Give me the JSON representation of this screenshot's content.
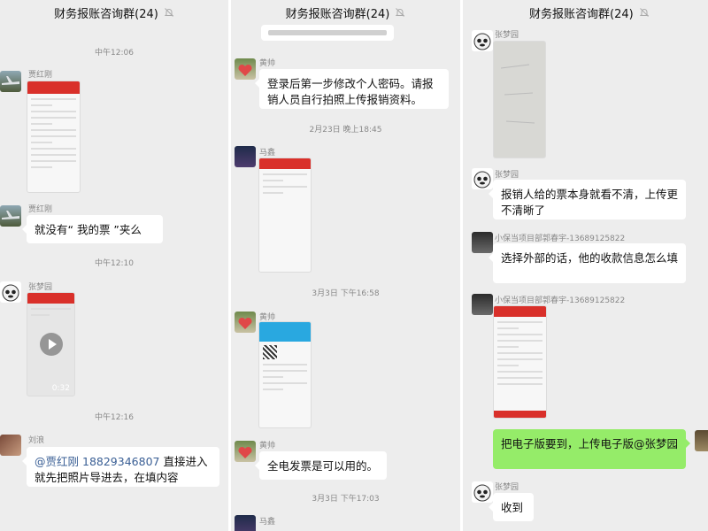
{
  "chat_title": "财务报账咨询群(24)",
  "panel1": {
    "time1": "中午12:06",
    "msg1_sender": "贾红刚",
    "msg2_sender": "贾红刚",
    "msg2_text": "就没有“ 我的票 ”夹么",
    "time2": "中午12:10",
    "msg3_sender": "张梦园",
    "msg3_video_duration": "0:32",
    "time3": "中午12:16",
    "msg4_sender": "刘浪",
    "msg4_mention": "@贾红刚",
    "msg4_phone": "18829346807",
    "msg4_text": "直接进入就先把照片导进去，在填内容"
  },
  "panel2": {
    "msg1_sender": "黄帅",
    "msg1_text": "登录后第一步修改个人密码。请报销人员自行拍照上传报销资料。",
    "time1": "2月23日 晚上18:45",
    "msg2_sender": "马鑫",
    "time2": "3月3日 下午16:58",
    "msg3_sender": "黄帅",
    "msg4_sender": "黄帅",
    "msg4_text": "全电发票是可以用的。",
    "time3": "3月3日 下午17:03",
    "msg5_sender": "马鑫"
  },
  "panel3": {
    "msg1_sender": "张梦园",
    "msg2_sender": "张梦园",
    "msg2_text": "报销人给的票本身就看不清，上传更不清晰了",
    "msg3_sender": "小保当项目部郭春宇-13689125822",
    "msg3_text": "选择外部的话，他的收款信息怎么填",
    "msg4_sender": "小保当项目部郭春宇-13689125822",
    "msg5_text": "把电子版要到，上传电子版@张梦园",
    "msg6_sender": "张梦园",
    "msg6_text": "收到"
  },
  "colors": {
    "background": "#ededed",
    "bubble_received": "#ffffff",
    "bubble_sent": "#95ec69",
    "accent_red": "#d9302a",
    "mention": "#3a5f95"
  }
}
